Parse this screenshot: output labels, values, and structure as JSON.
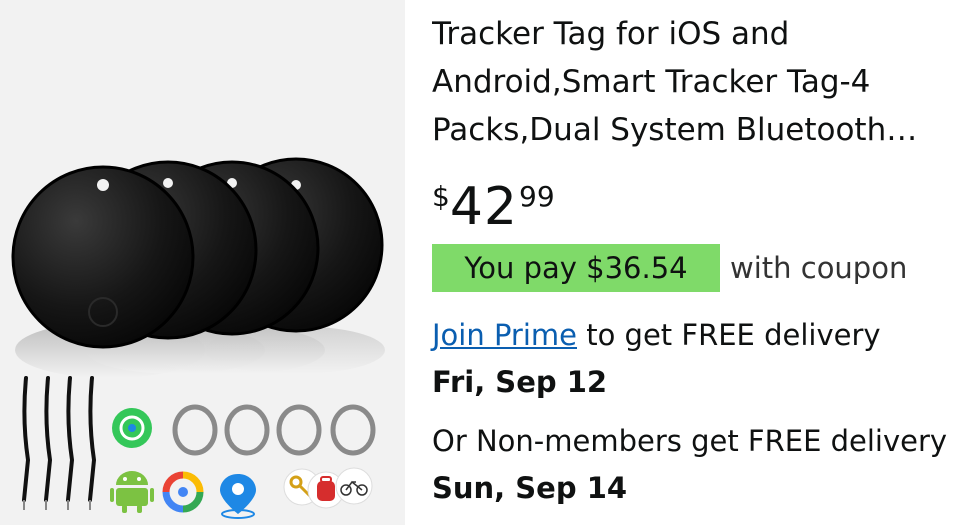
{
  "product": {
    "image_alt": "Tracker tags with lanyards and key rings",
    "title": "Tracker Tag for iOS and Android,Smart Tracker Tag-4 Packs,Dual System Bluetooth…",
    "price": {
      "symbol": "$",
      "whole": "42",
      "fraction": "99"
    },
    "coupon": {
      "badge": "You pay $36.54",
      "suffix": "with coupon",
      "badge_color": "#7fda69"
    },
    "delivery": {
      "link": "Join Prime",
      "text": " to get FREE delivery",
      "date": "Fri, Sep 12",
      "link_color": "#0a5eb0"
    },
    "nonmember": {
      "text": "Or Non-members get FREE delivery ",
      "date": "Sun, Sep 14"
    }
  },
  "icons": [
    "find-my-icon",
    "android-icon",
    "google-find-hub-icon",
    "location-pin-icon",
    "keys-icon",
    "backpack-icon",
    "bicycle-icon"
  ]
}
